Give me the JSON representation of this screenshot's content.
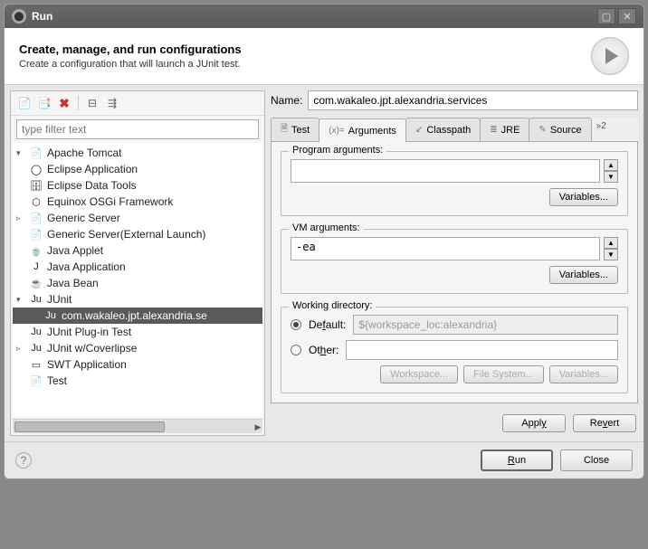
{
  "window": {
    "title": "Run"
  },
  "banner": {
    "title": "Create, manage, and run configurations",
    "desc": "Create a configuration that will launch a JUnit test."
  },
  "left": {
    "filter_placeholder": "type filter text",
    "items": [
      {
        "label": "Apache Tomcat",
        "icon": "📄",
        "expand": "▾",
        "indent": 0
      },
      {
        "label": "Eclipse Application",
        "icon": "◯",
        "indent": 0
      },
      {
        "label": "Eclipse Data Tools",
        "icon": "🗄",
        "indent": 0
      },
      {
        "label": "Equinox OSGi Framework",
        "icon": "⬡",
        "indent": 0
      },
      {
        "label": "Generic Server",
        "icon": "📄",
        "expand": "▹",
        "indent": 0
      },
      {
        "label": "Generic Server(External Launch)",
        "icon": "📄",
        "indent": 0
      },
      {
        "label": "Java Applet",
        "icon": "🍵",
        "indent": 0
      },
      {
        "label": "Java Application",
        "icon": "J",
        "indent": 0
      },
      {
        "label": "Java Bean",
        "icon": "☕",
        "indent": 0
      },
      {
        "label": "JUnit",
        "icon": "Ju",
        "expand": "▾",
        "indent": 0
      },
      {
        "label": "com.wakaleo.jpt.alexandria.se",
        "icon": "Ju",
        "indent": 1,
        "selected": true
      },
      {
        "label": "JUnit Plug-in Test",
        "icon": "Ju",
        "indent": 0
      },
      {
        "label": "JUnit w/Coverlipse",
        "icon": "Ju",
        "expand": "▹",
        "indent": 0
      },
      {
        "label": "SWT Application",
        "icon": "▭",
        "indent": 0
      },
      {
        "label": "Test",
        "icon": "📄",
        "indent": 0
      }
    ]
  },
  "right": {
    "name_label": "Name:",
    "name_value": "com.wakaleo.jpt.alexandria.services",
    "tabs": {
      "test": "Test",
      "arguments": "Arguments",
      "classpath": "Classpath",
      "jre": "JRE",
      "source": "Source",
      "overflow": "»2"
    },
    "program_args": {
      "legend": "Program arguments:",
      "value": "",
      "variables": "Variables..."
    },
    "vm_args": {
      "legend": "VM arguments:",
      "value": "-ea",
      "variables": "Variables..."
    },
    "working_dir": {
      "legend": "Working directory:",
      "default_label": "Default:",
      "default_value": "${workspace_loc:alexandria}",
      "other_label": "Other:",
      "other_value": "",
      "workspace_btn": "Workspace...",
      "filesystem_btn": "File System...",
      "variables_btn": "Variables..."
    },
    "apply": "Apply",
    "revert": "Revert"
  },
  "footer": {
    "run": "Run",
    "close": "Close"
  }
}
